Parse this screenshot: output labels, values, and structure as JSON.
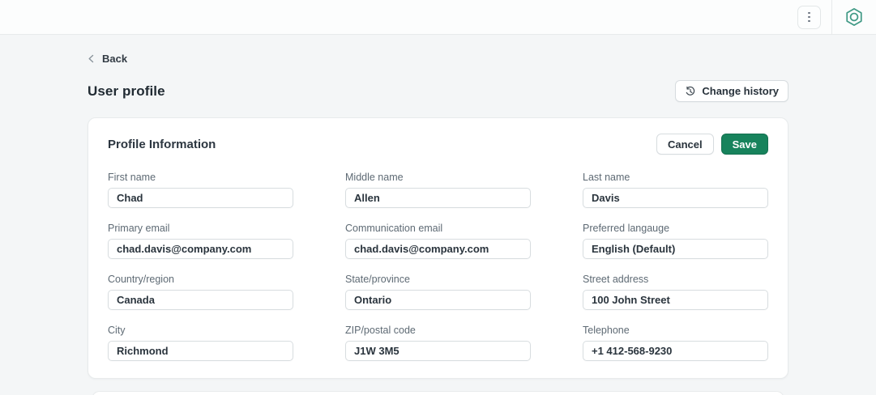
{
  "topbar": {
    "kebab_icon": "vertical-three-dots",
    "app_icon": "hexagon-nut"
  },
  "page": {
    "back_label": "Back",
    "title": "User profile",
    "change_history_label": "Change history"
  },
  "card": {
    "title": "Profile Information",
    "cancel_label": "Cancel",
    "save_label": "Save",
    "fields": [
      {
        "label": "First name",
        "value": "Chad"
      },
      {
        "label": "Middle name",
        "value": "Allen"
      },
      {
        "label": "Last name",
        "value": "Davis"
      },
      {
        "label": "Primary email",
        "value": "chad.davis@company.com"
      },
      {
        "label": "Communication email",
        "value": "chad.davis@company.com"
      },
      {
        "label": "Preferred langauge",
        "value": "English (Default)"
      },
      {
        "label": "Country/region",
        "value": "Canada"
      },
      {
        "label": "State/province",
        "value": "Ontario"
      },
      {
        "label": "Street address",
        "value": "100 John Street"
      },
      {
        "label": "City",
        "value": "Richmond"
      },
      {
        "label": "ZIP/postal code",
        "value": "J1W 3M5"
      },
      {
        "label": "Telephone",
        "value": "+1 412-568-9230"
      }
    ]
  },
  "colors": {
    "save_button": "#17835c",
    "logo_teal": "#419a86",
    "page_background": "#f4f6f7"
  }
}
